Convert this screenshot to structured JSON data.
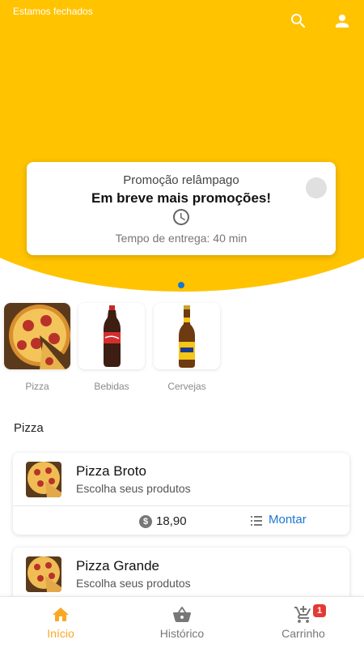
{
  "status": {
    "store_status": "Estamos fechados"
  },
  "header": {
    "search_icon": "search-icon",
    "profile_icon": "person-icon"
  },
  "promo": {
    "subtitle": "Promoção relâmpago",
    "title": "Em breve mais promoções!",
    "delivery_time": "Tempo de entrega: 40 min"
  },
  "carousel": {
    "active_index": 0,
    "count": 1
  },
  "categories": [
    {
      "label": "Pizza"
    },
    {
      "label": "Bebidas"
    },
    {
      "label": "Cervejas"
    }
  ],
  "section": {
    "title": "Pizza"
  },
  "products": [
    {
      "name": "Pizza Broto",
      "description": "Escolha seus produtos",
      "price": "18,90",
      "action": "Montar"
    },
    {
      "name": "Pizza Grande",
      "description": "Escolha seus produtos"
    }
  ],
  "nav": {
    "items": [
      {
        "label": "Início",
        "icon": "home-icon",
        "active": true
      },
      {
        "label": "Histórico",
        "icon": "basket-icon",
        "active": false
      },
      {
        "label": "Carrinho",
        "icon": "cart-add-icon",
        "active": false,
        "badge": "1"
      }
    ]
  },
  "colors": {
    "brand": "#ffc300",
    "link": "#1976d2",
    "active_nav": "#f9a825",
    "badge": "#e53935"
  }
}
